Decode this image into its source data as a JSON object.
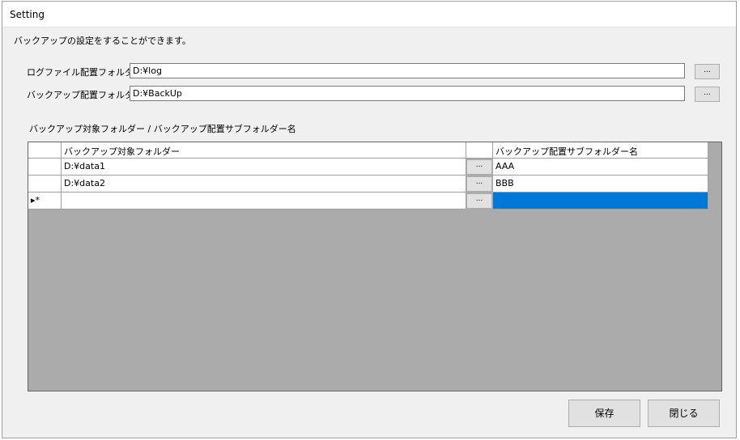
{
  "window": {
    "title": "Setting"
  },
  "description": "バックアップの設定をすることができます。",
  "log_folder": {
    "label": "ログファイル配置フォルダー",
    "value": "D:¥log",
    "browse_label": "..."
  },
  "backup_folder": {
    "label": "バックアップ配置フォルダー",
    "value": "D:¥BackUp",
    "browse_label": "..."
  },
  "grid_section_label": "バックアップ対象フォルダー / バックアップ配置サブフォルダー名",
  "grid": {
    "columns": [
      "バックアップ対象フォルダー",
      "バックアップ配置サブフォルダー名"
    ],
    "rows": [
      {
        "source": "D:¥data1",
        "browse": "...",
        "subfolder": "AAA"
      },
      {
        "source": "D:¥data2",
        "browse": "...",
        "subfolder": "BBB"
      },
      {
        "source": "",
        "browse": "...",
        "subfolder": ""
      }
    ],
    "new_row_marker": "▸*",
    "selection_color": "#0078d7"
  },
  "buttons": {
    "save": "保存",
    "close": "閉じる"
  }
}
